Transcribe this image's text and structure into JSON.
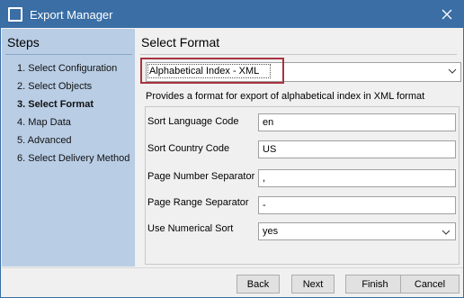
{
  "window": {
    "title": "Export Manager",
    "close_label": "✕"
  },
  "steps": {
    "title": "Steps",
    "items": [
      {
        "label": "1. Select Configuration",
        "active": false
      },
      {
        "label": "2. Select Objects",
        "active": false
      },
      {
        "label": "3. Select Format",
        "active": true
      },
      {
        "label": "4. Map Data",
        "active": false
      },
      {
        "label": "5. Advanced",
        "active": false
      },
      {
        "label": "6. Select Delivery Method",
        "active": false
      }
    ]
  },
  "main": {
    "title": "Select Format",
    "format_select": {
      "value": "Alphabetical Index - XML"
    },
    "description": "Provides a format for export of alphabetical index in XML format",
    "properties": [
      {
        "label": "Sort Language Code",
        "value": "en",
        "kind": "text"
      },
      {
        "label": "Sort Country Code",
        "value": "US",
        "kind": "text"
      },
      {
        "label": "Page Number Separator",
        "value": ",",
        "kind": "text"
      },
      {
        "label": "Page Range Separator",
        "value": "-",
        "kind": "text"
      },
      {
        "label": "Use Numerical Sort",
        "value": "yes",
        "kind": "select"
      }
    ]
  },
  "buttons": {
    "back": "Back",
    "next": "Next",
    "finish": "Finish",
    "cancel": "Cancel"
  },
  "colors": {
    "titlebar": "#3a6ea5",
    "steps_panel": "#b9cde5",
    "highlight": "#a8333f"
  }
}
